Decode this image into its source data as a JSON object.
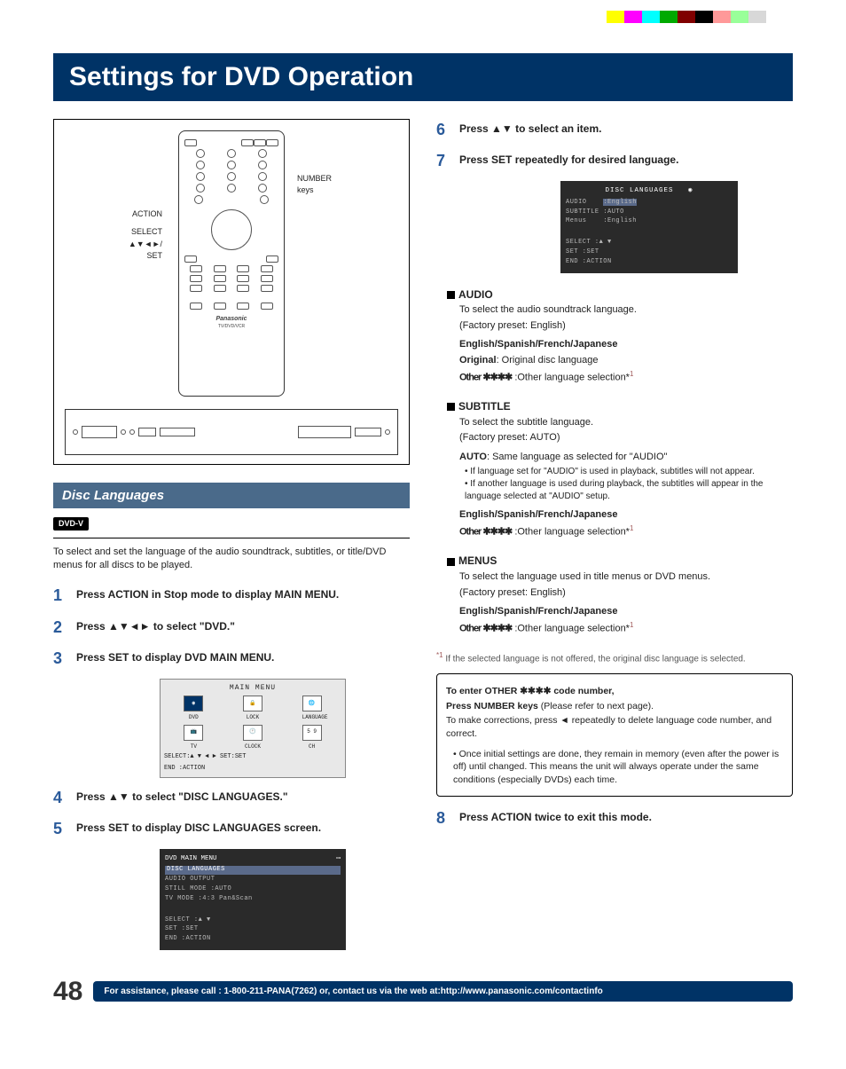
{
  "title": "Settings for DVD Operation",
  "remote_labels": {
    "action": "ACTION",
    "select": "SELECT",
    "arrows_set": "▲▼◄►/\nSET",
    "number_keys": "NUMBER\nkeys",
    "brand": "Panasonic",
    "model": "TV/DVD/VCR"
  },
  "section_header": "Disc Languages",
  "badge": "DVD-V",
  "intro": "To select and set the language of the audio soundtrack, subtitles, or title/DVD menus for all discs to be played.",
  "steps": [
    {
      "n": "1",
      "t": "Press ACTION in Stop mode to display MAIN MENU."
    },
    {
      "n": "2",
      "t": "Press ▲▼◄► to select \"DVD.\""
    },
    {
      "n": "3",
      "t": "Press SET to display DVD MAIN MENU."
    },
    {
      "n": "4",
      "t": "Press ▲▼ to select \"DISC LANGUAGES.\""
    },
    {
      "n": "5",
      "t": "Press SET to display DISC LANGUAGES screen."
    },
    {
      "n": "6",
      "t": "Press ▲▼ to select an item."
    },
    {
      "n": "7",
      "t": "Press SET repeatedly for desired language."
    },
    {
      "n": "8",
      "t": "Press ACTION twice to exit this mode."
    }
  ],
  "osd_main": {
    "title": "MAIN MENU",
    "icons": [
      "DVD",
      "LOCK",
      "LANGUAGE",
      "TV",
      "CLOCK",
      "CH"
    ],
    "foot1": "SELECT:▲ ▼ ◄ ►  SET:SET",
    "foot2": "END   :ACTION"
  },
  "osd_dvd": {
    "title": "DVD MAIN MENU",
    "lines": [
      "DISC LANGUAGES",
      "AUDIO OUTPUT",
      "STILL MODE     :AUTO",
      "TV MODE        :4:3 Pan&Scan"
    ],
    "foot": [
      "SELECT   :▲ ▼",
      "SET      :SET",
      "END      :ACTION"
    ]
  },
  "osd_disc": {
    "title": "DISC LANGUAGES",
    "lines": [
      {
        "k": "AUDIO",
        "v": ":English",
        "hl": true
      },
      {
        "k": "SUBTITLE",
        "v": ":AUTO",
        "hl": false
      },
      {
        "k": "Menus",
        "v": ":English",
        "hl": false
      }
    ],
    "foot": [
      "SELECT   :▲ ▼",
      "SET      :SET",
      "END      :ACTION"
    ]
  },
  "audio": {
    "head": "AUDIO",
    "p1": "To select the audio soundtrack language.",
    "p2": "(Factory preset: English)",
    "opts1": "English/Spanish/French/Japanese",
    "opts2a": "Original",
    "opts2b": ": Original disc language",
    "opts3a": "Other ✱✱✱✱",
    "opts3b": " :Other language selection*",
    "ref": "1"
  },
  "subtitle": {
    "head": "SUBTITLE",
    "p1": "To select the subtitle language.",
    "p2": "(Factory preset: AUTO)",
    "auto_a": "AUTO",
    "auto_b": ": Same language as selected for \"AUDIO\"",
    "b1": "If language set for \"AUDIO\" is used in playback, subtitles will not appear.",
    "b2": "If another language is used during playback, the subtitles will appear in the language selected at \"AUDIO\" setup.",
    "opts1": "English/Spanish/French/Japanese",
    "opts3a": "Other ✱✱✱✱",
    "opts3b": " :Other language selection*",
    "ref": "1"
  },
  "menus": {
    "head": "MENUS",
    "p1": "To select the language used in title menus or DVD menus.",
    "p2": "(Factory preset: English)",
    "opts1": "English/Spanish/French/Japanese",
    "opts3a": "Other ✱✱✱✱",
    "opts3b": " :Other language selection*",
    "ref": "1"
  },
  "footnote": {
    "ref": "*1",
    "text": " If the selected language is not offered, the original disc language is selected."
  },
  "boxnote": {
    "l1a": "To enter OTHER ✱✱✱✱ code number,",
    "l2a": "Press NUMBER keys",
    "l2b": " (Please refer to next page).",
    "l3": "To make corrections, press ◄ repeatedly to delete language code number, and correct.",
    "b1": "Once initial settings are done, they remain in memory (even after the power is off) until changed. This means the unit will always operate under the same conditions (especially DVDs) each time."
  },
  "page_num": "48",
  "footer": "For assistance, please call : 1-800-211-PANA(7262) or, contact us via the web at:http://www.panasonic.com/contactinfo"
}
